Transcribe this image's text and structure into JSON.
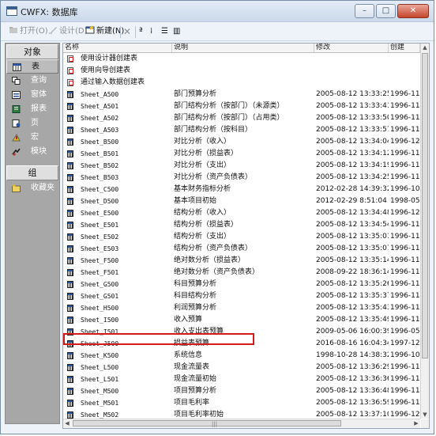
{
  "window": {
    "title": "CWFX: 数据库",
    "controls": {
      "minimize": "–",
      "maximize": "□",
      "close": "✕"
    }
  },
  "toolbar": {
    "open_label": "打开(O)",
    "design_label": "设计(D)",
    "new_label": "新建(N)",
    "delete_glyph": "✕",
    "large_icons_glyph": "ª",
    "small_icons_glyph": "⁞",
    "list_glyph": "☰",
    "details_glyph": "▥"
  },
  "sidebar": {
    "objects_header": "对象",
    "items": [
      {
        "label": "表",
        "icon": "table-icon",
        "selected": true
      },
      {
        "label": "查询",
        "icon": "query-icon",
        "selected": false
      },
      {
        "label": "窗体",
        "icon": "form-icon",
        "selected": false
      },
      {
        "label": "报表",
        "icon": "report-icon",
        "selected": false
      },
      {
        "label": "页",
        "icon": "page-icon",
        "selected": false
      },
      {
        "label": "宏",
        "icon": "macro-icon",
        "selected": false
      },
      {
        "label": "模块",
        "icon": "module-icon",
        "selected": false
      }
    ],
    "groups_header": "组",
    "group_items": [
      {
        "label": "收藏夹",
        "icon": "favorites-icon"
      }
    ]
  },
  "list": {
    "columns": [
      "名称",
      "说明",
      "修改",
      "创建"
    ],
    "rows": [
      {
        "type": "create",
        "name": "使用设计器创建表",
        "desc": "",
        "modified": "",
        "created": ""
      },
      {
        "type": "create",
        "name": "使用向导创建表",
        "desc": "",
        "modified": "",
        "created": ""
      },
      {
        "type": "create",
        "name": "通过输入数据创建表",
        "desc": "",
        "modified": "",
        "created": ""
      },
      {
        "type": "table",
        "name": "Sheet_A500",
        "desc": "部门预算分析",
        "modified": "2005-08-12 13:33:25",
        "created": "1996-11-2"
      },
      {
        "type": "table",
        "name": "Sheet_A501",
        "desc": "部门结构分析（按部门）（未源类）",
        "modified": "2005-08-12 13:33:41",
        "created": "1996-11-2"
      },
      {
        "type": "table",
        "name": "Sheet_A502",
        "desc": "部门结构分析（按部门）（占用类）",
        "modified": "2005-08-12 13:33:50",
        "created": "1996-11-2"
      },
      {
        "type": "table",
        "name": "Sheet_A503",
        "desc": "部门结构分析（按科目）",
        "modified": "2005-08-12 13:33:57",
        "created": "1996-11-2"
      },
      {
        "type": "table",
        "name": "Sheet_B500",
        "desc": "对比分析（收入）",
        "modified": "2005-08-12 13:34:04",
        "created": "1996-12-1"
      },
      {
        "type": "table",
        "name": "Sheet_B501",
        "desc": "对比分析（损益表）",
        "modified": "2005-08-12 13:34:12",
        "created": "1996-11-2"
      },
      {
        "type": "table",
        "name": "Sheet_B502",
        "desc": "对比分析（支出）",
        "modified": "2005-08-12 13:34:19",
        "created": "1996-11-2"
      },
      {
        "type": "table",
        "name": "Sheet_B503",
        "desc": "对比分析（资产负债表）",
        "modified": "2005-08-12 13:34:25",
        "created": "1996-11-2"
      },
      {
        "type": "table",
        "name": "Sheet_C500",
        "desc": "基本财务指标分析",
        "modified": "2012-02-28 14:39:32",
        "created": "1996-10-2"
      },
      {
        "type": "table",
        "name": "Sheet_D500",
        "desc": "基本项目初始",
        "modified": "2012-02-29 8:51:04",
        "created": "1998-05-0"
      },
      {
        "type": "table",
        "name": "Sheet_E500",
        "desc": "结构分析（收入）",
        "modified": "2005-08-12 13:34:48",
        "created": "1996-12-1"
      },
      {
        "type": "table",
        "name": "Sheet_E501",
        "desc": "结构分析（损益表）",
        "modified": "2005-08-12 13:34:54",
        "created": "1996-11-2"
      },
      {
        "type": "table",
        "name": "Sheet_E502",
        "desc": "结构分析（支出）",
        "modified": "2005-08-12 13:35:01",
        "created": "1996-11-2"
      },
      {
        "type": "table",
        "name": "Sheet_E503",
        "desc": "结构分析（资产负债表）",
        "modified": "2005-08-12 13:35:07",
        "created": "1996-11-2"
      },
      {
        "type": "table",
        "name": "Sheet_F500",
        "desc": "绝对数分析（损益表）",
        "modified": "2005-08-12 13:35:14",
        "created": "1996-11-2"
      },
      {
        "type": "table",
        "name": "Sheet_F501",
        "desc": "绝对数分析（资产负债表）",
        "modified": "2008-09-22 18:36:14",
        "created": "1996-11-2"
      },
      {
        "type": "table",
        "name": "Sheet_G500",
        "desc": "科目预算分析",
        "modified": "2005-08-12 13:35:26",
        "created": "1996-11-2"
      },
      {
        "type": "table",
        "name": "Sheet_G501",
        "desc": "科目结构分析",
        "modified": "2005-08-12 13:35:37",
        "created": "1996-11-2"
      },
      {
        "type": "table",
        "name": "Sheet_H500",
        "desc": "利润预算分析",
        "modified": "2005-08-12 13:35:43",
        "created": "1996-11-2"
      },
      {
        "type": "table",
        "name": "Sheet_I500",
        "desc": "收入预算",
        "modified": "2005-08-12 13:35:49",
        "created": "1996-11-2"
      },
      {
        "type": "table",
        "name": "Sheet_I501",
        "desc": "收入支出表预算",
        "modified": "2009-05-06 16:00:39",
        "created": "1996-05-1"
      },
      {
        "type": "table",
        "name": "Sheet_J500",
        "desc": "损益表预算",
        "modified": "2016-08-16 16:04:34",
        "created": "1997-12-2"
      },
      {
        "type": "table",
        "name": "Sheet_K500",
        "desc": "系统信息",
        "modified": "1998-10-28 14:38:32",
        "created": "1996-10-2"
      },
      {
        "type": "table",
        "name": "Sheet_L500",
        "desc": "现金流量表",
        "modified": "2005-08-12 13:36:29",
        "created": "1996-11-2"
      },
      {
        "type": "table",
        "name": "Sheet_L501",
        "desc": "现金流量初始",
        "modified": "2005-08-12 13:36:36",
        "created": "1996-11-2"
      },
      {
        "type": "table",
        "name": "Sheet_M500",
        "desc": "项目预算分析",
        "modified": "2005-08-12 13:36:48",
        "created": "1996-11-2"
      },
      {
        "type": "table",
        "name": "Sheet_M501",
        "desc": "项目毛利率",
        "modified": "2005-08-12 13:36:59",
        "created": "1996-11-1"
      },
      {
        "type": "table",
        "name": "Sheet_M502",
        "desc": "项目毛利率初始",
        "modified": "2005-08-12 13:37:10",
        "created": "1996-12-1"
      }
    ]
  },
  "scroll": {
    "grip": "|||"
  },
  "colors": {
    "highlight": "#d41a1a",
    "sidebar": "#a7a7a7"
  }
}
